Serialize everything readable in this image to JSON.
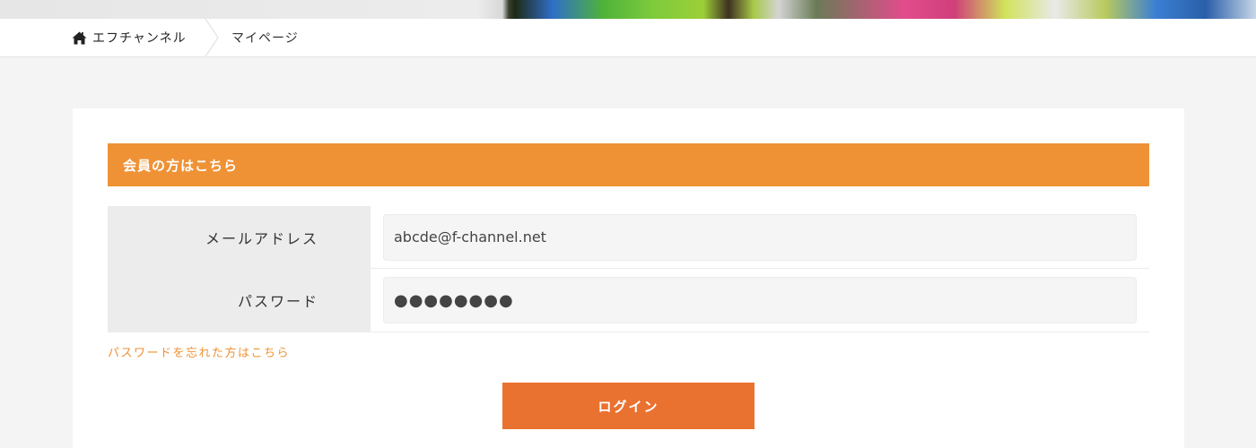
{
  "breadcrumb": {
    "home_label": "エフチャンネル",
    "current_label": "マイページ"
  },
  "login_panel": {
    "title": "会員の方はこちら",
    "email": {
      "label": "メールアドレス",
      "value": "abcde@f-channel.net"
    },
    "password": {
      "label": "パスワード",
      "value": "●●●●●●●●"
    },
    "forgot_link": "パスワードを忘れた方はこちら",
    "login_button": "ログイン"
  },
  "colors": {
    "header_orange": "#ef9236",
    "button_orange": "#ea7230",
    "link_orange": "#ef9236"
  },
  "icons": {
    "home": "home-icon"
  }
}
